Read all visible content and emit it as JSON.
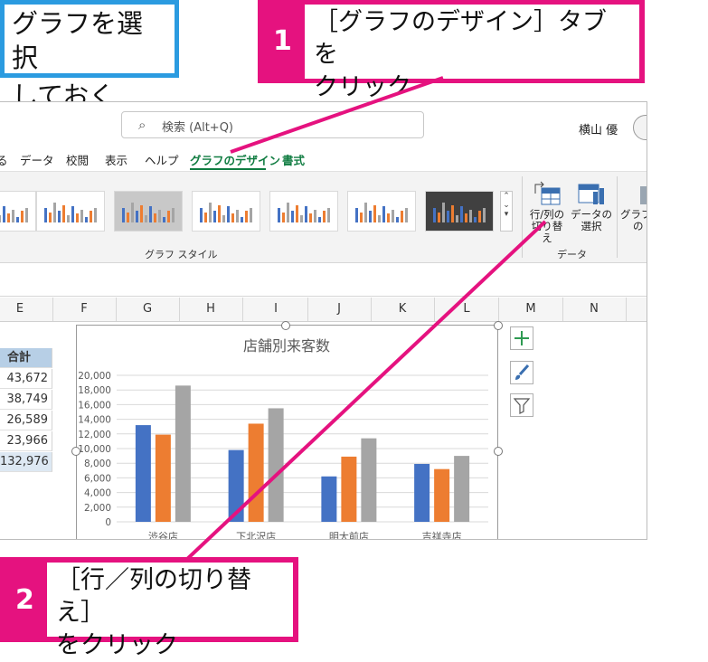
{
  "callouts": {
    "note": "グラフを選択しておく",
    "note_line1": "グラフを選択",
    "note_line2": "しておく",
    "step1": {
      "number": "1",
      "line1": "［グラフのデザイン］タブを",
      "line2": "クリック"
    },
    "step2": {
      "number": "2",
      "line1": "［行／列の切り替え］",
      "line2": "をクリック"
    }
  },
  "titlebar": {
    "search_placeholder": "検索 (Alt+Q)",
    "user_name": "横山 優"
  },
  "menu": {
    "items": [
      "データ",
      "校閲",
      "表示",
      "ヘルプ",
      "グラフのデザイン",
      "書式"
    ],
    "active": "グラフのデザイン"
  },
  "ribbon": {
    "group_styles_label": "グラフ スタイル",
    "group_data_label": "データ",
    "switch_row_col_line1": "行/列の",
    "switch_row_col_line2": "切り替え",
    "select_data_line1": "データの",
    "select_data_line2": "選択",
    "next_partial_line1": "グラフ",
    "next_partial_line2": "の"
  },
  "columns": [
    "E",
    "F",
    "G",
    "H",
    "I",
    "J",
    "K",
    "L",
    "M",
    "N"
  ],
  "sum_column": {
    "header": "合計",
    "values": [
      "43,672",
      "38,749",
      "26,589",
      "23,966",
      "132,976"
    ]
  },
  "chart_data": {
    "type": "bar",
    "title": "店舗別来客数",
    "categories": [
      "渋谷店",
      "下北沢店",
      "明大前店",
      "吉祥寺店"
    ],
    "series": [
      {
        "values": [
          13200,
          9800,
          6200,
          7900
        ],
        "color": "#4472c4"
      },
      {
        "values": [
          11900,
          13400,
          8900,
          7200
        ],
        "color": "#ed7d31"
      },
      {
        "values": [
          18600,
          15500,
          11400,
          9000
        ],
        "color": "#a5a5a5"
      }
    ],
    "ylim": [
      0,
      20000
    ],
    "yticks": [
      "20,000",
      "18,000",
      "16,000",
      "14,000",
      "12,000",
      "10,000",
      "8,000",
      "6,000",
      "4,000",
      "2,000",
      "0"
    ],
    "grid": true
  },
  "colors": {
    "accent_pink": "#e5127f",
    "accent_blue": "#2b9be0",
    "excel_green": "#107c41"
  }
}
